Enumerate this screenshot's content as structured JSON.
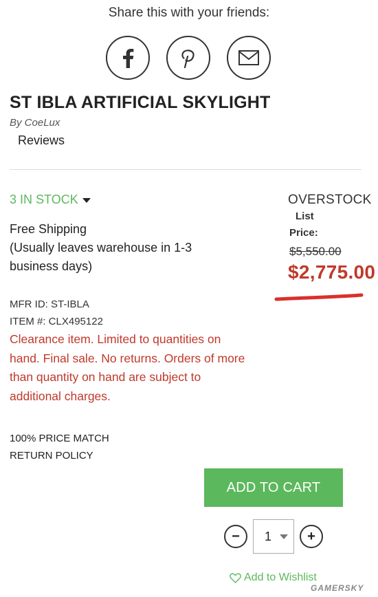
{
  "share": {
    "title": "Share this with your friends:",
    "buttons": [
      {
        "icon": "facebook-icon"
      },
      {
        "icon": "pinterest-icon"
      },
      {
        "icon": "email-icon"
      }
    ]
  },
  "product": {
    "title": "ST IBLA ARTIFICIAL SKYLIGHT",
    "brand": "By CoeLux",
    "reviews_label": "Reviews"
  },
  "stock": {
    "status": "3 IN STOCK",
    "status_color": "#5cb85c"
  },
  "shipping": {
    "title": "Free Shipping",
    "note": "(Usually leaves warehouse in 1-3 business days)"
  },
  "ids": {
    "mfr_id": "MFR ID: ST-IBLA",
    "item_no": "ITEM #: CLX495122"
  },
  "clearance": {
    "text": "Clearance item. Limited to quantities on hand. Final sale. No returns. Orders of more than quantity on hand are subject to additional charges.",
    "color": "#c0392b"
  },
  "policy": {
    "price_match": "100% PRICE MATCH",
    "return_policy": "RETURN POLICY"
  },
  "pricing": {
    "badge": "OVERSTOCK",
    "list_label": "List",
    "price_label": "Price:",
    "list_price": "$5,550.00",
    "sale_price": "$2,775.00",
    "sale_color": "#c0392b"
  },
  "cart": {
    "add_label": "ADD TO CART",
    "quantity": "1",
    "minus_label": "−",
    "plus_label": "+",
    "wishlist_label": "Add to Wishlist",
    "accent": "#5cb85c"
  },
  "watermark": "GAMERSKY"
}
